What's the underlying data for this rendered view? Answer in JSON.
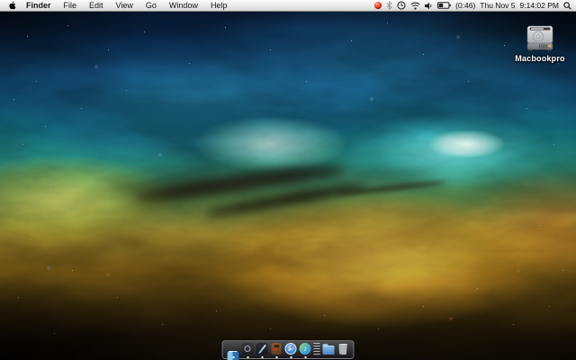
{
  "menubar": {
    "apple_menu": "apple-logo",
    "menus": [
      "Finder",
      "File",
      "Edit",
      "View",
      "Go",
      "Window",
      "Help"
    ],
    "status": {
      "icons": [
        "red-orb",
        "bluetooth",
        "time-machine",
        "wifi",
        "volume",
        "battery",
        "spotlight"
      ],
      "battery_time": "(0:46)",
      "date": "Thu Nov 5",
      "time": "9:14:02 PM"
    }
  },
  "desktop": {
    "volume_label": "Macbookpro",
    "volume_icon": "hard-drive"
  },
  "dock": {
    "items": [
      {
        "name": "finder",
        "label": "Finder",
        "running": true
      },
      {
        "name": "dark-aperture-app",
        "label": "Dark aperture app",
        "running": true
      },
      {
        "name": "pen-app",
        "label": "Pen app",
        "running": true
      },
      {
        "name": "brown-mascot-app",
        "label": "Brown mascot app",
        "running": true
      },
      {
        "name": "safari",
        "label": "Safari",
        "running": true
      },
      {
        "name": "itunes",
        "label": "iTunes",
        "running": true
      },
      {
        "name": "separator",
        "label": "Separator",
        "running": false
      },
      {
        "name": "documents-folder",
        "label": "Documents folder",
        "running": false
      },
      {
        "name": "trash",
        "label": "Trash",
        "running": false
      }
    ]
  },
  "colors": {
    "menubar_bg": "#ececec",
    "nebula_teal": "#35c8c0",
    "nebula_green": "#9aa32f",
    "nebula_gold": "#d9a52e",
    "nebula_orange": "#c47a1e",
    "sky_navy": "#0a2440",
    "dust_brown": "#2e1c10",
    "dock_bg": "#222226"
  }
}
